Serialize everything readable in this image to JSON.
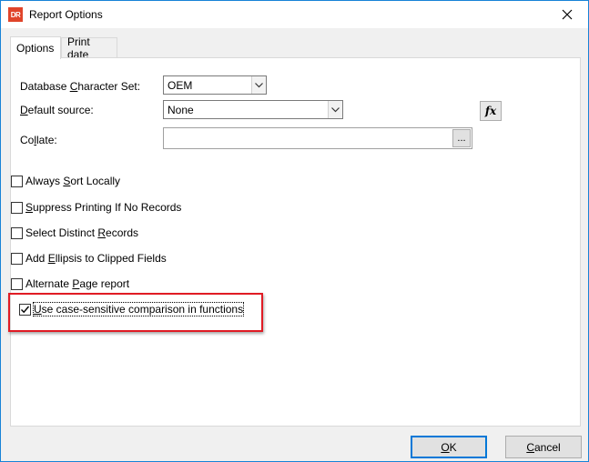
{
  "window": {
    "title": "Report Options",
    "app_icon_text": "DR"
  },
  "tabs": [
    {
      "label": "Options",
      "active": true
    },
    {
      "label": "Print date",
      "active": false
    }
  ],
  "fields": {
    "charset": {
      "label_pre": "Database ",
      "label_u": "C",
      "label_post": "haracter Set:",
      "value": "OEM"
    },
    "source": {
      "label_pre": "",
      "label_u": "D",
      "label_post": "efault source:",
      "value": "None"
    },
    "collate": {
      "label_pre": "Co",
      "label_u": "l",
      "label_post": "late:",
      "value": "",
      "browse_label": "..."
    }
  },
  "checkboxes": [
    {
      "pre": "Always ",
      "u": "S",
      "post": "ort Locally",
      "checked": false
    },
    {
      "pre": "",
      "u": "S",
      "post": "uppress Printing If No Records",
      "checked": false
    },
    {
      "pre": "Select Distinct ",
      "u": "R",
      "post": "ecords",
      "checked": false
    },
    {
      "pre": "Add ",
      "u": "E",
      "post": "llipsis to Clipped Fields",
      "checked": false
    },
    {
      "pre": "Alternate ",
      "u": "P",
      "post": "age report",
      "checked": false
    },
    {
      "pre": "",
      "u": "U",
      "post": "se case-sensitive comparison in functions",
      "checked": true
    }
  ],
  "fx_label": "fx",
  "buttons": {
    "ok": {
      "u": "O",
      "post": "K"
    },
    "cancel": {
      "u": "C",
      "post": "ancel"
    }
  },
  "colors": {
    "highlight": "#e01b24",
    "accent": "#0078d7"
  }
}
